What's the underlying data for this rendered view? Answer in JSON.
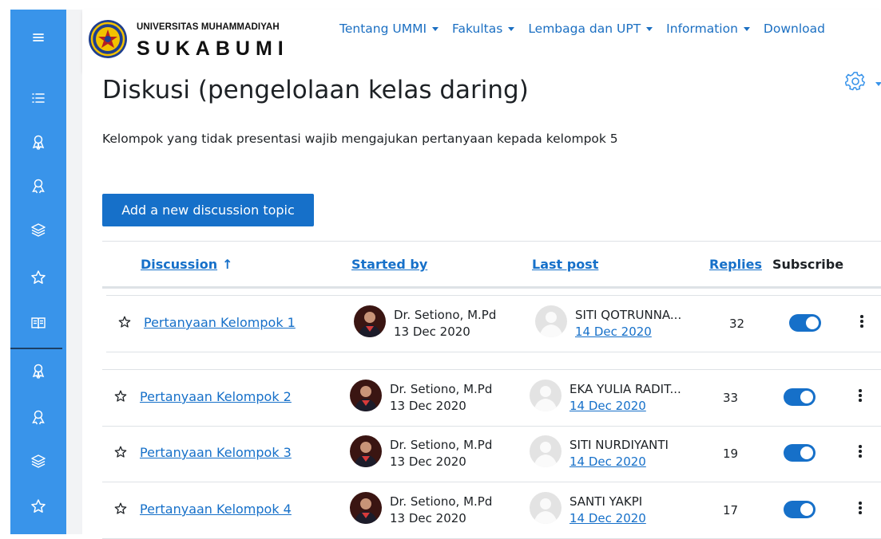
{
  "brand": {
    "line1": "UNIVERSITAS MUHAMMADIYAH",
    "line2": "SUKABUMI"
  },
  "nav": {
    "items": [
      {
        "label": "Tentang UMMI",
        "has_caret": true
      },
      {
        "label": "Fakultas",
        "has_caret": true
      },
      {
        "label": "Lembaga dan UPT",
        "has_caret": true
      },
      {
        "label": "Information",
        "has_caret": true
      },
      {
        "label": "Download",
        "has_caret": false
      }
    ]
  },
  "rail": {
    "icons": [
      "menu-icon",
      "list-icon",
      "badge-icon",
      "award-icon",
      "layers-icon",
      "star-icon",
      "book-icon",
      "badge-icon",
      "award-icon",
      "layers-icon",
      "star-icon"
    ]
  },
  "page": {
    "title": "Diskusi (pengelolaan kelas daring)",
    "intro": "Kelompok yang tidak presentasi wajib mengajukan pertanyaan kepada kelompok 5",
    "add_button": "Add a new discussion topic"
  },
  "table": {
    "headers": {
      "discussion": "Discussion",
      "started_by": "Started by",
      "last_post": "Last post",
      "replies": "Replies",
      "subscribe": "Subscribe"
    },
    "rows": [
      {
        "title": "Pertanyaan Kelompok 1",
        "starter": "Dr. Setiono, M.Pd",
        "start_date": "13 Dec 2020",
        "last_by": "SITI QOTRUNNA...",
        "last_date": "14 Dec 2020",
        "replies": "32",
        "subscribed": true
      },
      {
        "title": "Pertanyaan Kelompok 2",
        "starter": "Dr. Setiono, M.Pd",
        "start_date": "13 Dec 2020",
        "last_by": "EKA YULIA RADIT...",
        "last_date": "14 Dec 2020",
        "replies": "33",
        "subscribed": true
      },
      {
        "title": "Pertanyaan Kelompok 3",
        "starter": "Dr. Setiono, M.Pd",
        "start_date": "13 Dec 2020",
        "last_by": "SITI NURDIYANTI",
        "last_date": "14 Dec 2020",
        "replies": "19",
        "subscribed": true
      },
      {
        "title": "Pertanyaan Kelompok 4",
        "starter": "Dr. Setiono, M.Pd",
        "start_date": "13 Dec 2020",
        "last_by": "SANTI YAKPI",
        "last_date": "14 Dec 2020",
        "replies": "17",
        "subscribed": true
      }
    ]
  },
  "colors": {
    "rail": "#3994ea",
    "primary": "#1670c9",
    "link": "#1b6fc2"
  }
}
